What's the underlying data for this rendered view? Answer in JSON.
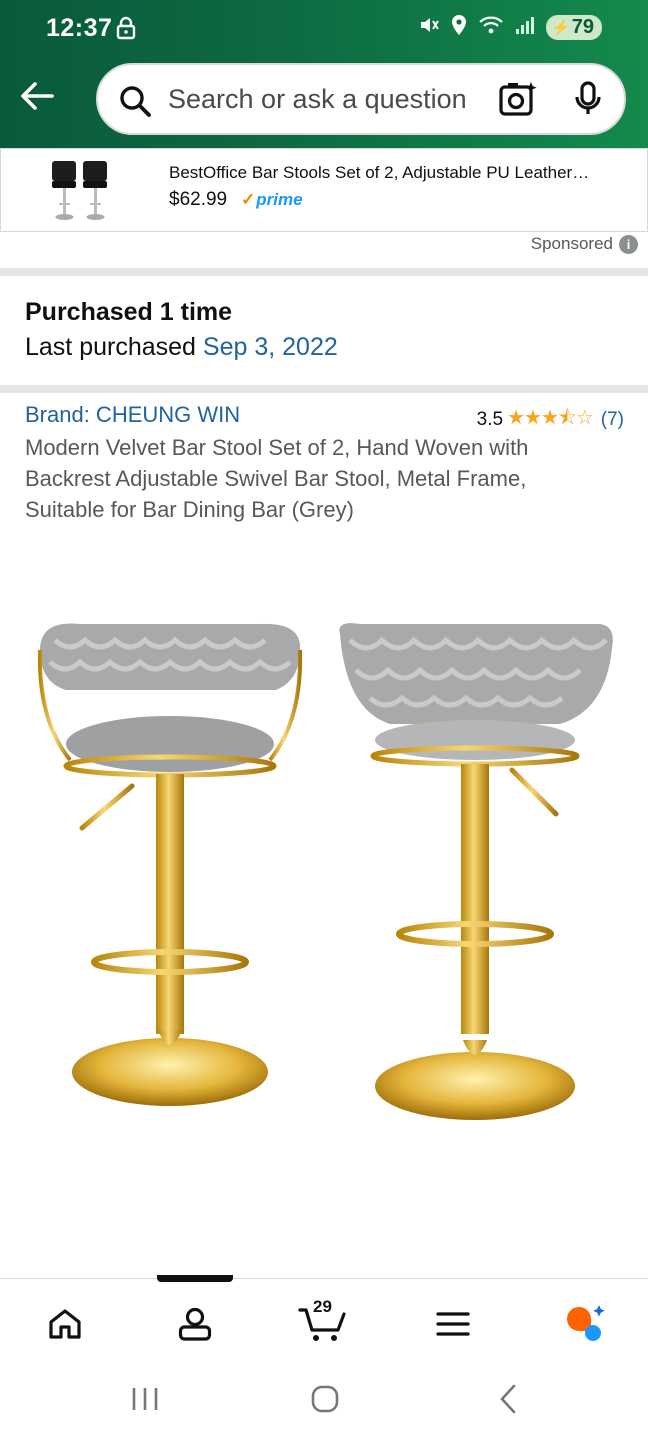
{
  "status": {
    "time": "12:37",
    "battery": "79",
    "icons": [
      "lock-icon",
      "mute-icon",
      "location-icon",
      "wifi-icon",
      "signal-icon",
      "battery-icon"
    ]
  },
  "search": {
    "placeholder": "Search or ask a question"
  },
  "ad": {
    "title": "BestOffice Bar Stools Set of 2, Adjustable PU Leather…",
    "price": "$62.99",
    "prime": "prime",
    "sponsored_label": "Sponsored"
  },
  "purchase": {
    "purchased_text": "Purchased 1 time",
    "last_prefix": "Last purchased ",
    "last_date": "Sep 3, 2022"
  },
  "product": {
    "brand": "Brand: CHEUNG WIN",
    "rating": "3.5",
    "rating_fraction": 0.7,
    "stars": "★★★⯪☆",
    "rating_count": "(7)",
    "title": "Modern Velvet Bar Stool Set of 2, Hand Woven with Backrest Adjustable Swivel Bar Stool, Metal Frame, Suitable for Bar Dining Bar (Grey)"
  },
  "nav": {
    "items": [
      "home-icon",
      "account-icon",
      "cart-icon",
      "menu-icon",
      "rufus-icon"
    ],
    "cart_count": "29",
    "active": "account"
  },
  "colors": {
    "header_start": "#0a5a3a",
    "header_end": "#148a4c",
    "link": "#2162a1",
    "star": "#f8a41d",
    "prime": "#1a98ff"
  }
}
